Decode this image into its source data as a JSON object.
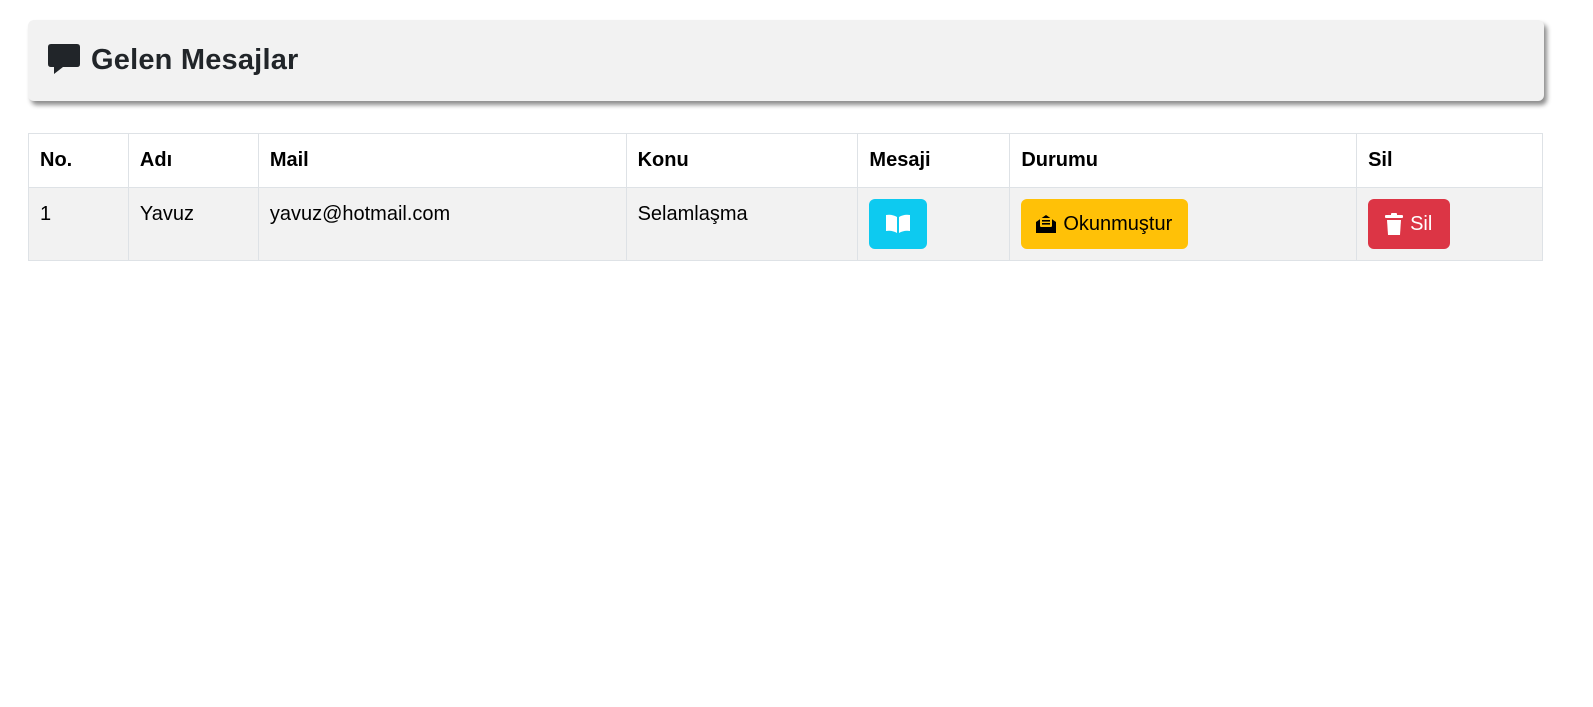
{
  "header": {
    "icon": "chat-bubble-icon",
    "title": "Gelen Mesajlar"
  },
  "table": {
    "columns": [
      "No.",
      "Adı",
      "Mail",
      "Konu",
      "Mesaji",
      "Durumu",
      "Sil"
    ],
    "rows": [
      {
        "no": "1",
        "name": "Yavuz",
        "mail": "yavuz@hotmail.com",
        "subject": "Selamlaşma",
        "message_icon": "open-book-icon",
        "status_icon": "envelope-open-text-icon",
        "status_label": "Okunmuştur",
        "delete_icon": "trash-icon",
        "delete_label": "Sil"
      }
    ]
  },
  "colors": {
    "info": "#0dcaf0",
    "warning": "#ffc107",
    "danger": "#dc3545",
    "header_bg": "#f2f2f2",
    "row_bg": "#f2f2f2"
  }
}
